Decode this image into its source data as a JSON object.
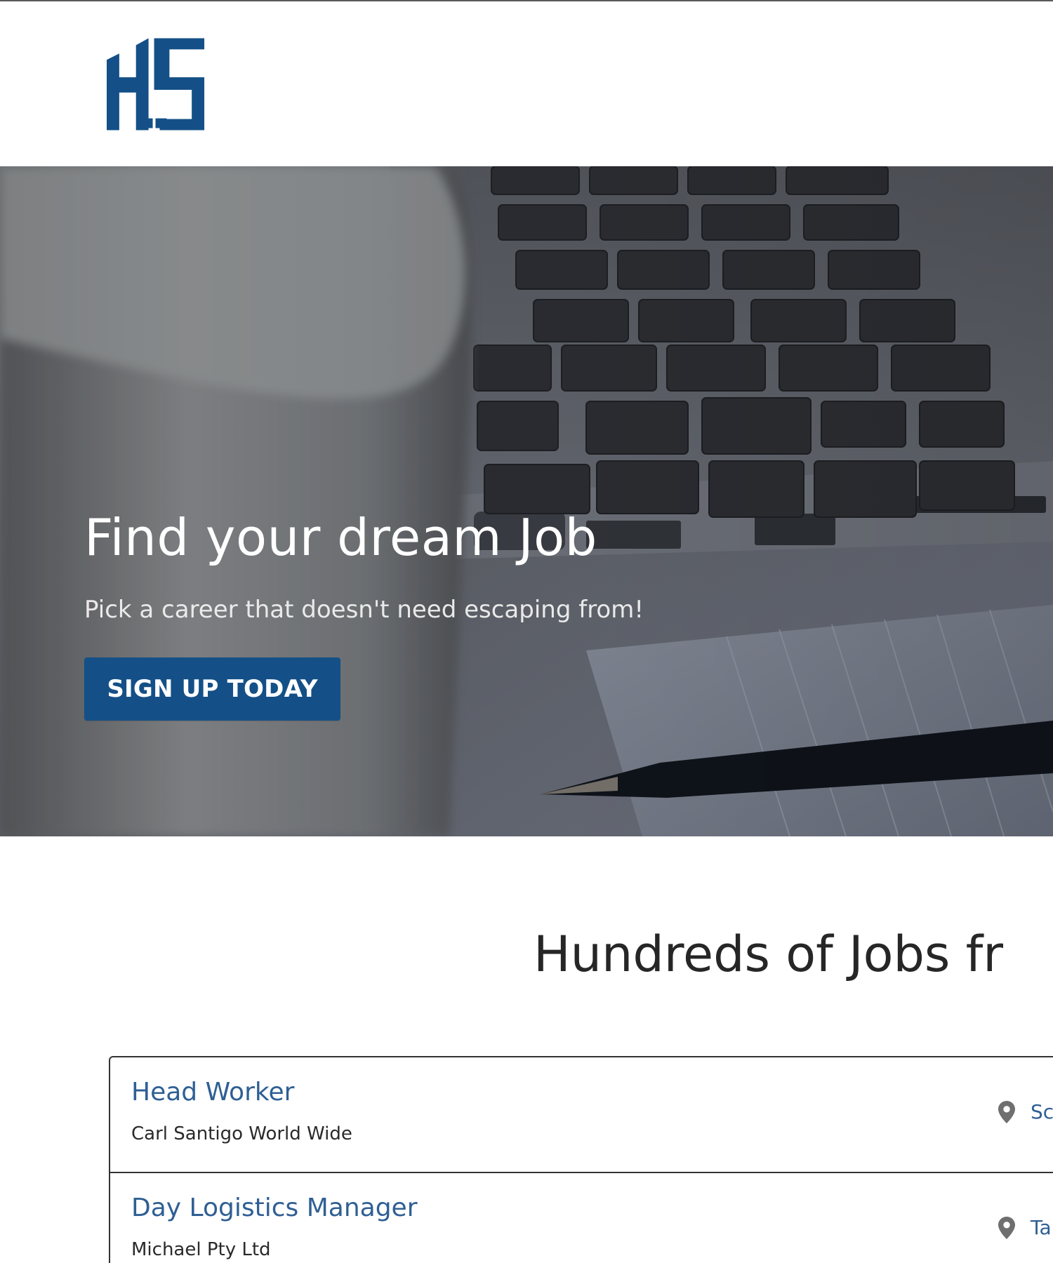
{
  "brand": {
    "logo_text": "HS",
    "primary_color": "#145087",
    "dark_color": "#262626",
    "link_color": "#2F5F94"
  },
  "hero": {
    "title": "Find your dream Job",
    "subtitle": "Pick a career that doesn't need escaping from!",
    "cta_label": "SIGN UP TODAY"
  },
  "jobs": {
    "heading": "Hundreds of Jobs fr",
    "items": [
      {
        "title": "Head Worker",
        "company": "Carl Santigo World Wide",
        "location": "Sc",
        "location_icon": "map-pin-icon"
      },
      {
        "title": "Day Logistics Manager",
        "company": "Michael Pty Ltd",
        "location": "Ta",
        "location_icon": "map-pin-icon"
      }
    ]
  }
}
